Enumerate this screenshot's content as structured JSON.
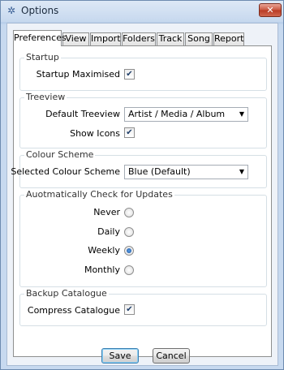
{
  "window": {
    "title": "Options",
    "close_label": "✕"
  },
  "tabs": [
    "Preferences",
    "View",
    "Import",
    "Folders",
    "Track",
    "Song",
    "Report"
  ],
  "startup": {
    "title": "Startup",
    "maximised_label": "Startup Maximised",
    "maximised_checked": true
  },
  "treeview": {
    "title": "Treeview",
    "default_label": "Default Treeview",
    "default_value": "Artist / Media / Album",
    "show_icons_label": "Show Icons",
    "show_icons_checked": true
  },
  "colour_scheme": {
    "title": "Colour Scheme",
    "selected_label": "Selected Colour Scheme",
    "selected_value": "Blue (Default)"
  },
  "updates": {
    "title": "Auotmatically Check for Updates",
    "options": [
      "Never",
      "Daily",
      "Weekly",
      "Monthly"
    ],
    "selected": "Weekly"
  },
  "backup": {
    "title": "Backup Catalogue",
    "compress_label": "Compress Catalogue",
    "compress_checked": true
  },
  "buttons": {
    "save": "Save",
    "cancel": "Cancel"
  },
  "icons": {
    "app": "gear-icon",
    "check": "checkmark-icon",
    "dropdown": "chevron-down-icon"
  }
}
